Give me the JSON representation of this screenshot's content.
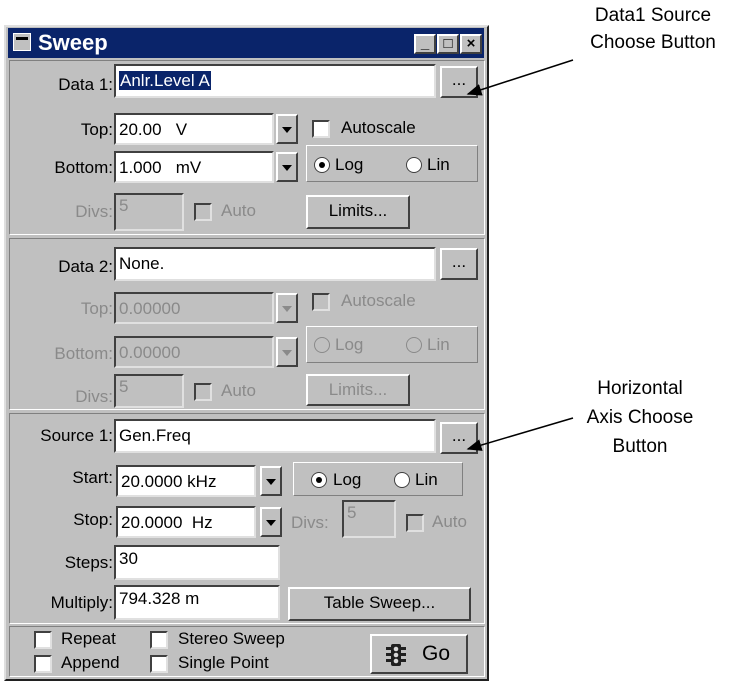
{
  "window": {
    "title": "Sweep",
    "minimize_glyph": "_",
    "restore_glyph": "□",
    "close_glyph": "×"
  },
  "data1": {
    "label": "Data 1:",
    "value": "Anlr.Level A",
    "choose_label": "...",
    "top_label": "Top:",
    "top_value": "20.00   V",
    "autoscale_label": "Autoscale",
    "autoscale_checked": false,
    "bottom_label": "Bottom:",
    "bottom_value": "1.000   mV",
    "log_label": "Log",
    "lin_label": "Lin",
    "scale": "Log",
    "divs_label": "Divs:",
    "divs_value": "5",
    "auto_label": "Auto",
    "limits_label": "Limits..."
  },
  "data2": {
    "label": "Data 2:",
    "value": "None.",
    "choose_label": "...",
    "top_label": "Top:",
    "top_value": "0.00000",
    "autoscale_label": "Autoscale",
    "bottom_label": "Bottom:",
    "bottom_value": "0.00000",
    "log_label": "Log",
    "lin_label": "Lin",
    "divs_label": "Divs:",
    "divs_value": "5",
    "auto_label": "Auto",
    "limits_label": "Limits..."
  },
  "source1": {
    "label": "Source 1:",
    "value": "Gen.Freq",
    "choose_label": "...",
    "start_label": "Start:",
    "start_value": "20.0000 kHz",
    "log_label": "Log",
    "lin_label": "Lin",
    "scale": "Log",
    "stop_label": "Stop:",
    "stop_value": "20.0000  Hz",
    "divs_label": "Divs:",
    "divs_value": "5",
    "auto_label": "Auto",
    "steps_label": "Steps:",
    "steps_value": "30",
    "multiply_label": "Multiply:",
    "multiply_value": "794.328 m",
    "table_sweep_label": "Table Sweep..."
  },
  "options": {
    "repeat_label": "Repeat",
    "stereo_label": "Stereo Sweep",
    "append_label": "Append",
    "single_label": "Single Point",
    "go_label": "Go"
  },
  "annotations": {
    "data1_callout": [
      "Data1 Source",
      "Choose Button"
    ],
    "source1_callout": [
      "Horizontal",
      "Axis Choose",
      "Button"
    ]
  },
  "colors": {
    "titlebar": "#0a246a",
    "face": "#c0c0c0",
    "selection": "#0a246a"
  },
  "icons": {
    "window_menu": "window-icon",
    "go": "traffic-light-icon"
  }
}
